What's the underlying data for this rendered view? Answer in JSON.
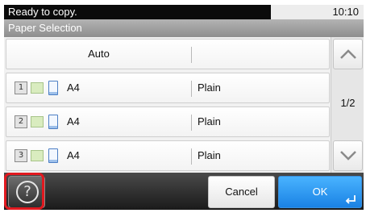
{
  "status": {
    "message": "Ready to copy.",
    "time": "10:10"
  },
  "title": "Paper Selection",
  "list": {
    "auto_label": "Auto",
    "rows": [
      {
        "tray": "1",
        "size": "A4",
        "type": "Plain"
      },
      {
        "tray": "2",
        "size": "A4",
        "type": "Plain"
      },
      {
        "tray": "3",
        "size": "A4",
        "type": "Plain"
      }
    ]
  },
  "pager": {
    "page": "1/2"
  },
  "buttons": {
    "cancel": "Cancel",
    "ok": "OK",
    "help_glyph": "?"
  },
  "colors": {
    "accent_ok": "#1a82e4",
    "help_highlight": "#e1191f"
  },
  "icons": {
    "help": "help-icon",
    "scroll_up": "chevron-up-icon",
    "scroll_down": "chevron-down-icon",
    "enter": "enter-icon"
  }
}
